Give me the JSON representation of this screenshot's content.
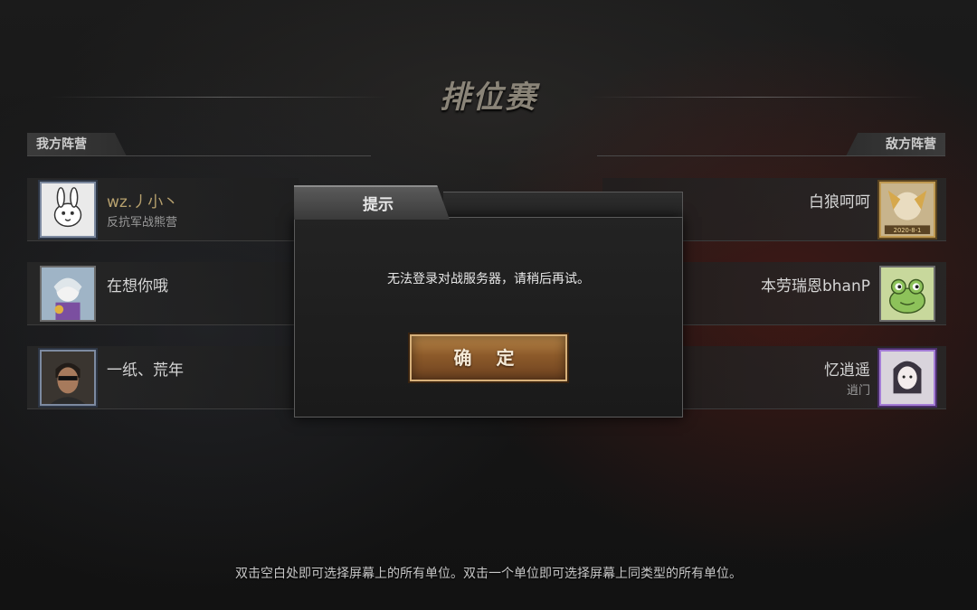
{
  "title": "排位赛",
  "my_team": {
    "label": "我方阵营",
    "players": [
      {
        "name": "wz.丿小丶",
        "subtitle": "反抗军战熊营"
      },
      {
        "name": "在想你哦",
        "subtitle": ""
      },
      {
        "name": "一纸、荒年",
        "subtitle": ""
      }
    ]
  },
  "enemy_team": {
    "label": "敌方阵营",
    "players": [
      {
        "name": "白狼呵呵",
        "subtitle": "",
        "badge": "2020-8-1"
      },
      {
        "name": "本劳瑞恩bhanP",
        "subtitle": ""
      },
      {
        "name": "忆逍遥",
        "subtitle": "逍门"
      }
    ]
  },
  "dialog": {
    "title": "提示",
    "message": "无法登录对战服务器，请稍后再试。",
    "confirm_label": "确 定"
  },
  "hint": "双击空白处即可选择屏幕上的所有单位。双击一个单位即可选择屏幕上同类型的所有单位。"
}
